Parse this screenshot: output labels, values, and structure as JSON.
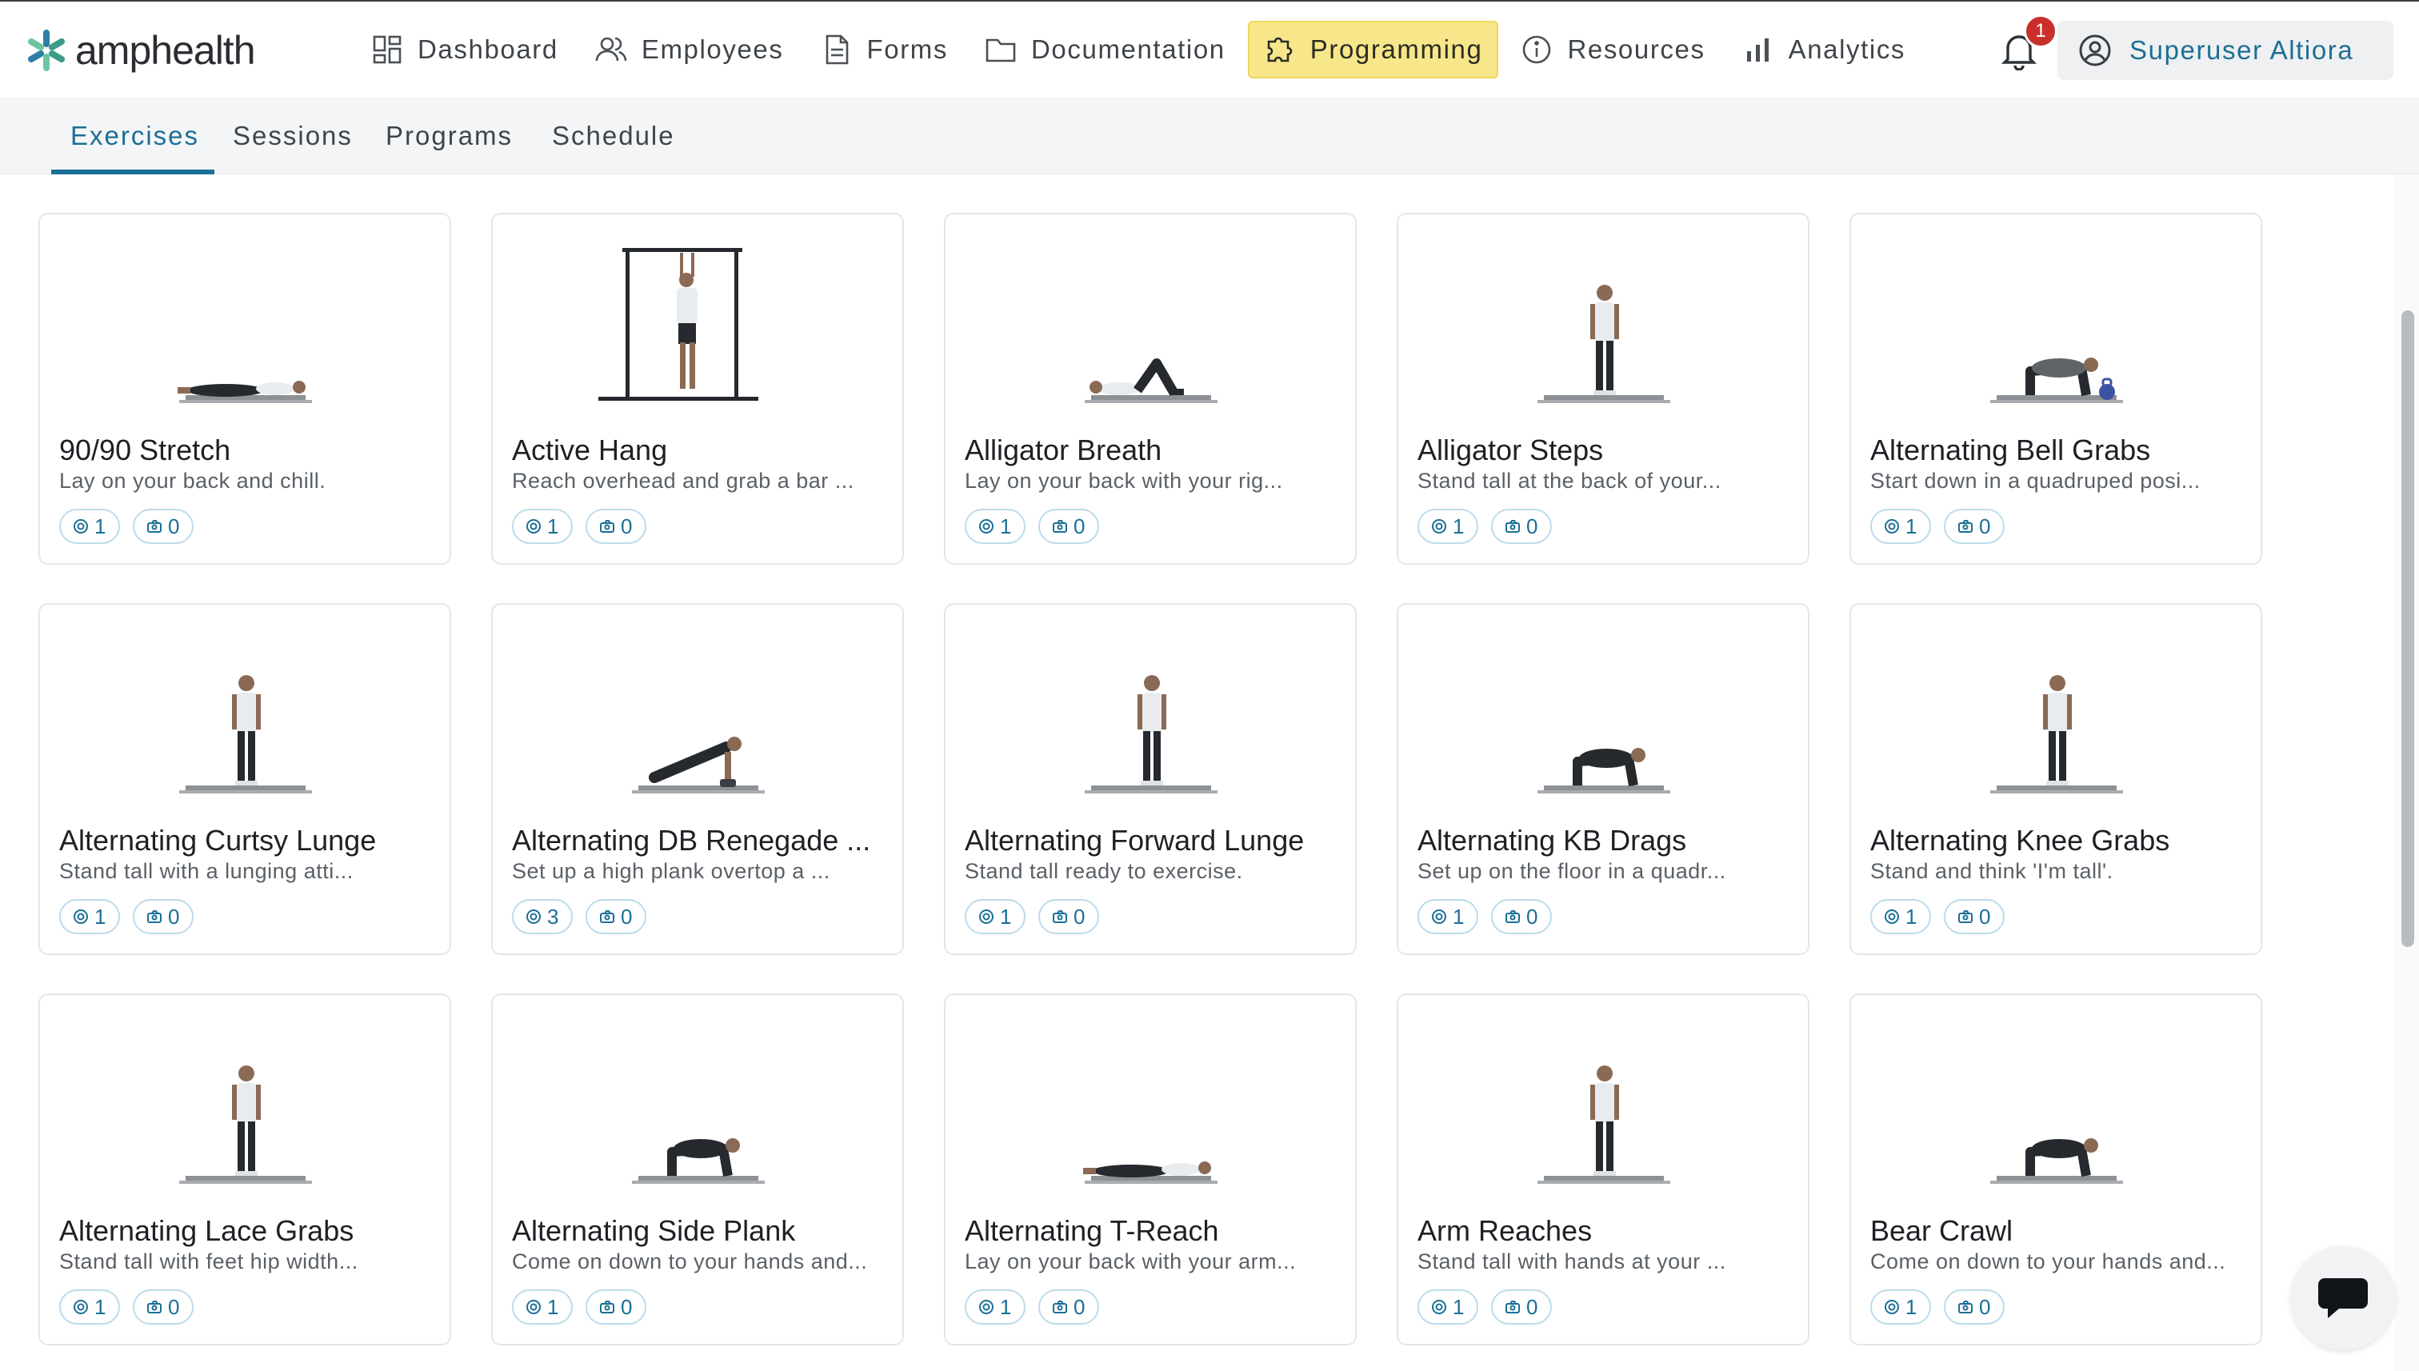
{
  "brand": {
    "name": "amphealth",
    "accent": "#1b6f96",
    "highlight": "#f8e78a"
  },
  "nav": {
    "items": [
      {
        "label": "Dashboard",
        "icon": "dashboard-icon",
        "active": false
      },
      {
        "label": "Employees",
        "icon": "employees-icon",
        "active": false
      },
      {
        "label": "Forms",
        "icon": "forms-icon",
        "active": false
      },
      {
        "label": "Documentation",
        "icon": "folder-icon",
        "active": false
      },
      {
        "label": "Programming",
        "icon": "puzzle-icon",
        "active": true
      },
      {
        "label": "Resources",
        "icon": "info-icon",
        "active": false
      },
      {
        "label": "Analytics",
        "icon": "bar-chart-icon",
        "active": false
      }
    ]
  },
  "notifications": {
    "count": "1",
    "icon": "bell-icon"
  },
  "user": {
    "name": "Superuser Altiora",
    "icon": "user-circle-icon"
  },
  "subtabs": [
    {
      "label": "Exercises",
      "active": true
    },
    {
      "label": "Sessions",
      "active": false
    },
    {
      "label": "Programs",
      "active": false
    },
    {
      "label": "Schedule",
      "active": false
    }
  ],
  "exercises": [
    {
      "title": "90/90 Stretch",
      "desc": "Lay on your back and chill.",
      "a": "1",
      "b": "0",
      "pose": "lying"
    },
    {
      "title": "Active Hang",
      "desc": "Reach overhead and grab a bar ...",
      "a": "1",
      "b": "0",
      "pose": "hang"
    },
    {
      "title": "Alligator Breath",
      "desc": "Lay on your back with your rig...",
      "a": "1",
      "b": "0",
      "pose": "lying-knees"
    },
    {
      "title": "Alligator Steps",
      "desc": "Stand tall at the back of your...",
      "a": "1",
      "b": "0",
      "pose": "standing"
    },
    {
      "title": "Alternating Bell Grabs",
      "desc": "Start down in a quadruped posi...",
      "a": "1",
      "b": "0",
      "pose": "quadruped-bell"
    },
    {
      "title": "Alternating Curtsy Lunge",
      "desc": "Stand tall with a lunging atti...",
      "a": "1",
      "b": "0",
      "pose": "standing"
    },
    {
      "title": "Alternating DB Renegade ...",
      "desc": "Set up a high plank overtop a ...",
      "a": "3",
      "b": "0",
      "pose": "plank"
    },
    {
      "title": "Alternating Forward Lunge",
      "desc": "Stand tall ready to exercise.",
      "a": "1",
      "b": "0",
      "pose": "standing"
    },
    {
      "title": "Alternating KB Drags",
      "desc": "Set up on the floor in a quadr...",
      "a": "1",
      "b": "0",
      "pose": "quadruped"
    },
    {
      "title": "Alternating Knee Grabs",
      "desc": "Stand and think 'I'm tall'.",
      "a": "1",
      "b": "0",
      "pose": "standing"
    },
    {
      "title": "Alternating Lace Grabs",
      "desc": "Stand tall with feet hip width...",
      "a": "1",
      "b": "0",
      "pose": "standing"
    },
    {
      "title": "Alternating Side Plank",
      "desc": "Come on down to your hands and...",
      "a": "1",
      "b": "0",
      "pose": "quadruped"
    },
    {
      "title": "Alternating T-Reach",
      "desc": "Lay on your back with your arm...",
      "a": "1",
      "b": "0",
      "pose": "lying"
    },
    {
      "title": "Arm Reaches",
      "desc": "Stand tall with hands at your ...",
      "a": "1",
      "b": "0",
      "pose": "standing"
    },
    {
      "title": "Bear Crawl",
      "desc": "Come on down to your hands and...",
      "a": "1",
      "b": "0",
      "pose": "quadruped"
    }
  ],
  "chat": {
    "icon": "chat-bubble-icon"
  }
}
